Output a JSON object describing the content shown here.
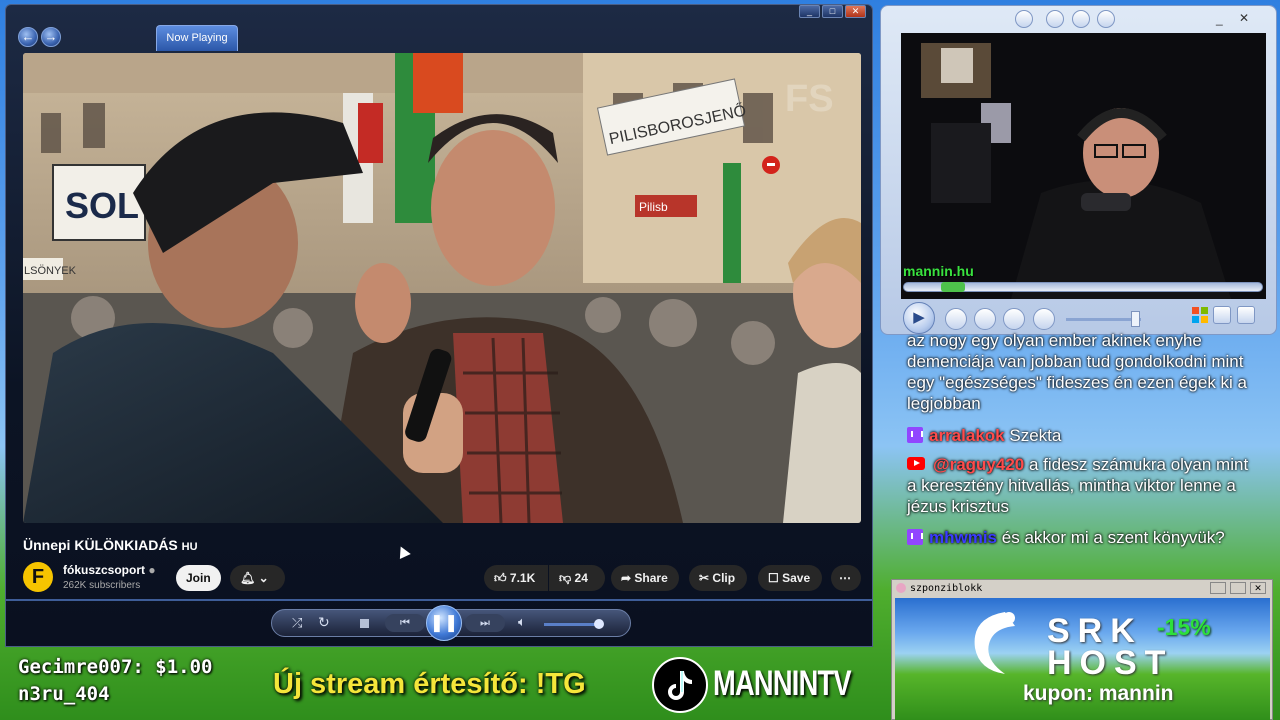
{
  "player": {
    "tab_now_playing": "Now Playing",
    "video_title": "Ünnepi KÜLÖNKIADÁS",
    "video_title_suffix": "HU",
    "channel_name": "fókuszcsoport",
    "subscribers": "262K subscribers",
    "join_label": "Join",
    "likes": "7.1K",
    "dislikes": "24",
    "share_label": "Share",
    "clip_label": "Clip",
    "save_label": "Save",
    "video_sign_1": "SOL",
    "video_sign_2": "PILISBOROSJENŐ",
    "video_sign_3": "Pilisb",
    "video_sign_4": "LSÖNYEK",
    "watermark": "FS"
  },
  "mini_player": {
    "caption": "mannin.hu"
  },
  "chat": {
    "messages": [
      {
        "platform": "none",
        "user": "",
        "text": "az nogy egy olyan ember akinek enyhe demenciája van jobban tud gondolkodni mint egy \"egészséges\" fideszes én ezen égek ki a legjobban"
      },
      {
        "platform": "twitch",
        "user": "arralakok",
        "user_color": "#ff4b4b",
        "text": "Szekta"
      },
      {
        "platform": "youtube",
        "user": "@raguy420",
        "user_color": "#ff4b4b",
        "text": "a fidesz számukra olyan mint a keresztény hitvallás, mintha viktor lenne a jézus krisztus"
      },
      {
        "platform": "twitch",
        "user": "mhwmis",
        "user_color": "#3b3bff",
        "text": "és akkor mi a szent könyvük?"
      }
    ]
  },
  "sponsor": {
    "window_title": "szponziblokk",
    "brand_line1": "SRK",
    "brand_line2": "HOST",
    "discount": "-15%",
    "coupon": "kupon: mannin"
  },
  "overlay": {
    "donation_1": "Gecimre007: $1.00",
    "donation_2": "n3ru_404",
    "notice": "Új stream értesítő: !TG",
    "tiktok_handle": "MANNINTV"
  }
}
